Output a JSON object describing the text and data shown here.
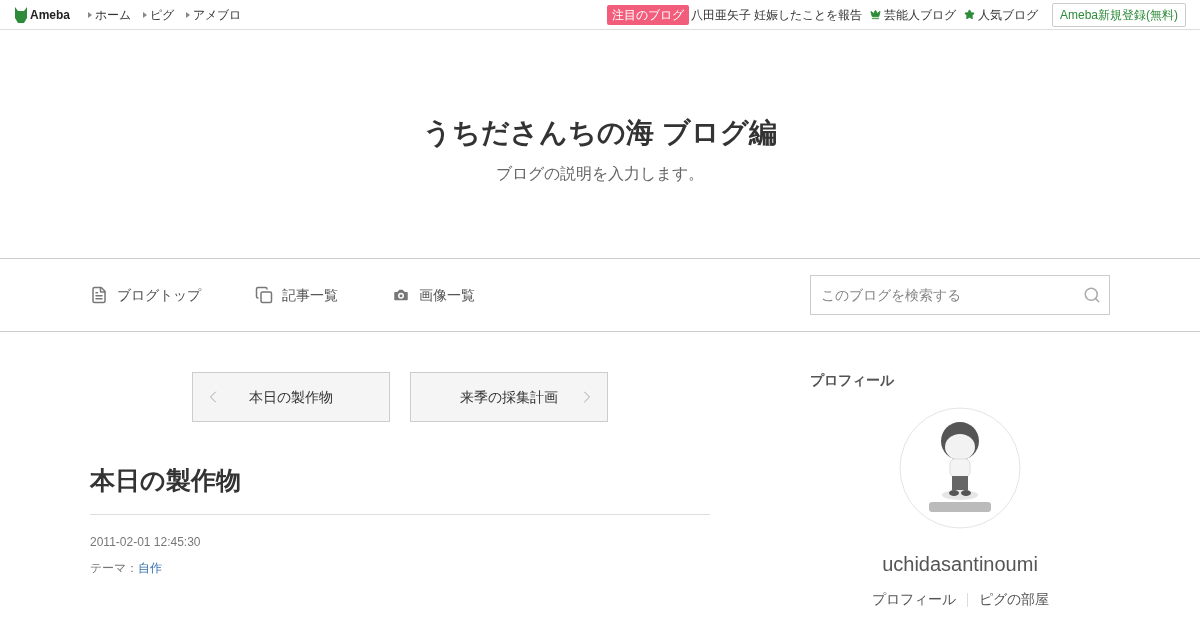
{
  "topbar": {
    "logo": "Ameba",
    "links": [
      "ホーム",
      "ピグ",
      "アメブロ"
    ],
    "featured_badge": "注目のブログ",
    "featured_text": "八田亜矢子 妊娠したことを報告",
    "ranking_links": [
      {
        "kind": "crown",
        "label": "芸能人ブログ"
      },
      {
        "kind": "star",
        "label": "人気ブログ"
      }
    ],
    "signup": "Ameba新規登録(無料)"
  },
  "header": {
    "title": "うちださんちの海 ブログ編",
    "description": "ブログの説明を入力します。"
  },
  "nav": {
    "items": [
      {
        "kind": "top",
        "label": "ブログトップ"
      },
      {
        "kind": "list",
        "label": "記事一覧"
      },
      {
        "kind": "images",
        "label": "画像一覧"
      }
    ],
    "search": {
      "placeholder": "このブログを検索する"
    }
  },
  "pager": {
    "prev": "本日の製作物",
    "next": "来季の採集計画"
  },
  "article": {
    "title": "本日の製作物",
    "date": "2011-02-01 12:45:30",
    "theme_label": "テーマ：",
    "theme": "自作"
  },
  "profile": {
    "heading": "プロフィール",
    "avatar": {
      "kind": "picture"
    },
    "name": "uchidasantinoumi",
    "links": [
      "プロフィール",
      "ピグの部屋"
    ]
  }
}
